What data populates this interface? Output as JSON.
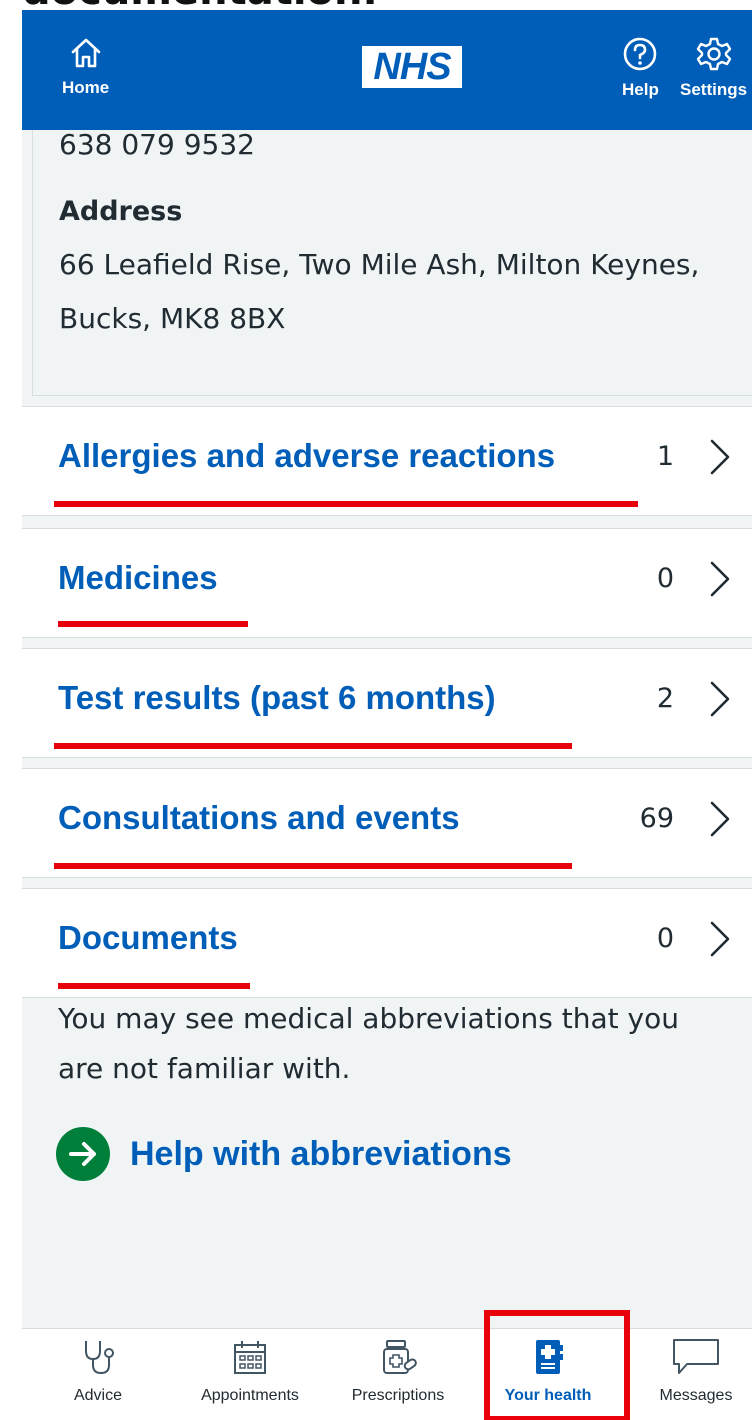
{
  "top_caption": "documentation.",
  "header": {
    "home_label": "Home",
    "logo_text": "NHS",
    "help_label": "Help",
    "settings_label": "Settings"
  },
  "details": {
    "phone": "638 079 9532",
    "address_label": "Address",
    "address_value": "66 Leafield Rise, Two Mile Ash, Milton Keynes, Bucks, MK8 8BX"
  },
  "rows": [
    {
      "title": "Allergies and adverse reactions",
      "count": "1"
    },
    {
      "title": "Medicines",
      "count": "0"
    },
    {
      "title": "Test results (past 6 months)",
      "count": "2"
    },
    {
      "title": "Consultations and events",
      "count": "69"
    },
    {
      "title": "Documents",
      "count": "0"
    }
  ],
  "abbreviations_note": "You may see medical abbreviations that you are not familiar with.",
  "help_link": "Help with abbreviations",
  "tabs": [
    {
      "label": "Advice",
      "icon": "stethoscope-icon"
    },
    {
      "label": "Appointments",
      "icon": "calendar-icon"
    },
    {
      "label": "Prescriptions",
      "icon": "prescription-icon"
    },
    {
      "label": "Your health",
      "icon": "health-record-icon",
      "active": true
    },
    {
      "label": "Messages",
      "icon": "message-icon"
    }
  ],
  "colors": {
    "brand_blue": "#005eb8",
    "link_green": "#007f3b",
    "annotation_red": "#e8000b",
    "background": "#f0f4f5"
  }
}
